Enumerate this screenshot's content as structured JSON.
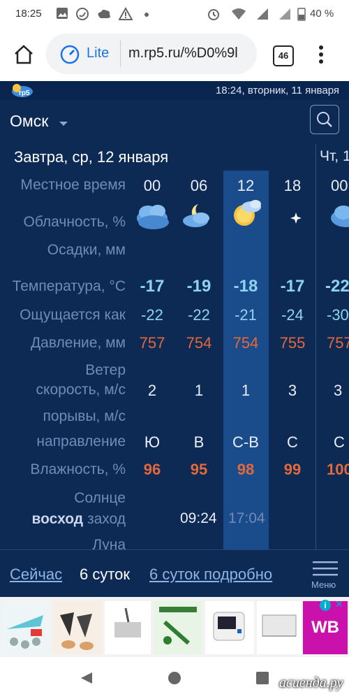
{
  "status_bar": {
    "time": "18:25",
    "battery": "40 %"
  },
  "browser": {
    "lite_label": "Lite",
    "url": "m.rp5.ru/%D0%9l",
    "tabs_count": "46"
  },
  "app": {
    "logo": "rp5",
    "datetime": "18:24, вторник, 11 января",
    "city": "Омск",
    "day_title": "Завтра, ср, 12 января",
    "next_day_title": "Чт, 1",
    "labels": {
      "local_time": "Местное время",
      "cloudiness": "Облачность, %",
      "precipitation": "Осадки, мм",
      "temperature": "Температура, °C",
      "feels_like": "Ощущается как",
      "pressure": "Давление, мм",
      "wind": "Ветер",
      "wind_speed": "скорость, м/с",
      "gusts": "порывы, м/с",
      "direction": "направление",
      "humidity": "Влажность, %",
      "sun": "Солнце",
      "sunrise": "восход",
      "sunset": "заход",
      "moon": "Луна"
    },
    "hours": [
      "00",
      "06",
      "12",
      "18",
      "00"
    ],
    "cloud_icons": [
      "cloudy-icon",
      "partly-cloudy-night-icon",
      "partly-cloudy-day-icon",
      "clear-night-icon",
      "cloudy-icon"
    ],
    "temperature": [
      "-17",
      "-19",
      "-18",
      "-17",
      "-22"
    ],
    "feels_like": [
      "-22",
      "-22",
      "-21",
      "-24",
      "-30"
    ],
    "pressure": [
      "757",
      "754",
      "754",
      "755",
      "757"
    ],
    "wind_speed": [
      "2",
      "1",
      "1",
      "3",
      "3"
    ],
    "direction": [
      "Ю",
      "В",
      "С-В",
      "С",
      "С"
    ],
    "humidity": [
      "96",
      "95",
      "98",
      "99",
      "100"
    ],
    "sunrise_time": "09:24",
    "sunset_time": "17:04"
  },
  "bottom_nav": {
    "now": "Сейчас",
    "six_days": "6 суток",
    "six_days_detailed": "6 суток подробно",
    "menu": "Меню"
  },
  "ad_choices": "i",
  "ad_brand": "WB",
  "watermark": "асиенда.ру",
  "colors": {
    "bg": "#0d2a55",
    "accent_blue": "#8fd3f2",
    "accent_orange": "#e4683a",
    "label": "#6f8bb8"
  }
}
